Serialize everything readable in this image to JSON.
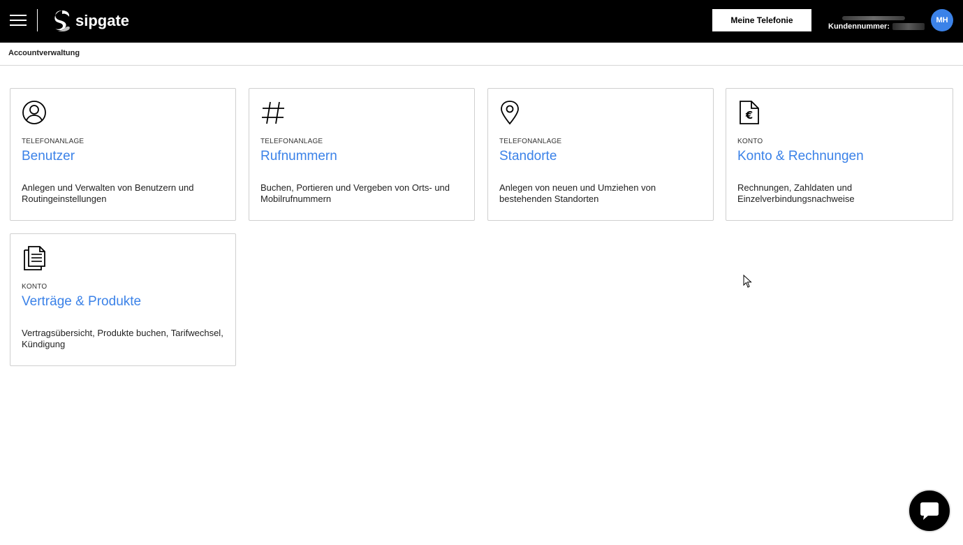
{
  "header": {
    "logo_text": "sipgate",
    "telefonie_button": "Meine Telefonie",
    "kundennummer_label": "Kundennummer:",
    "avatar_initials": "MH"
  },
  "breadcrumb": {
    "current": "Accountverwaltung"
  },
  "cards": [
    {
      "icon": "user-circle-icon",
      "category": "TELEFONANLAGE",
      "title": "Benutzer",
      "description": "Anlegen und Verwalten von Benutzern und Routingeinstellungen"
    },
    {
      "icon": "hash-icon",
      "category": "TELEFONANLAGE",
      "title": "Rufnummern",
      "description": "Buchen, Portieren und Vergeben von Orts- und Mobilrufnummern"
    },
    {
      "icon": "location-pin-icon",
      "category": "TELEFONANLAGE",
      "title": "Standorte",
      "description": "Anlegen von neuen und Umziehen von bestehenden Standorten"
    },
    {
      "icon": "euro-document-icon",
      "category": "KONTO",
      "title": "Konto & Rechnungen",
      "description": "Rechnungen, Zahldaten und Einzelverbindungsnachweise"
    },
    {
      "icon": "documents-icon",
      "category": "KONTO",
      "title": "Verträge & Produkte",
      "description": "Vertragsübersicht, Produkte buchen, Tarifwechsel, Kündigung"
    }
  ],
  "colors": {
    "topbar": "#000000",
    "accent": "#3b82e8",
    "border": "#cfcfcf"
  }
}
